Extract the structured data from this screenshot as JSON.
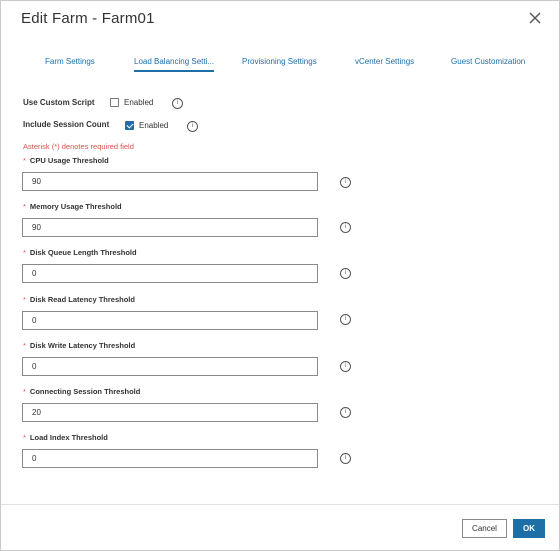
{
  "dialog": {
    "title": "Edit Farm - Farm01",
    "close_icon": "close-icon"
  },
  "tabs": [
    {
      "label": "Farm Settings",
      "active": false
    },
    {
      "label": "Load Balancing Setti...",
      "active": true
    },
    {
      "label": "Provisioning Settings",
      "active": false
    },
    {
      "label": "vCenter Settings",
      "active": false
    },
    {
      "label": "Guest Customization",
      "active": false
    }
  ],
  "options": {
    "custom_script": {
      "label": "Use Custom Script",
      "checkbox_label": "Enabled",
      "checked": false
    },
    "session_count": {
      "label": "Include Session Count",
      "checkbox_label": "Enabled",
      "checked": true
    }
  },
  "required_note": "Asterisk (*) denotes required field",
  "fields": [
    {
      "label": "CPU Usage Threshold",
      "value": "90"
    },
    {
      "label": "Memory Usage Threshold",
      "value": "90"
    },
    {
      "label": "Disk Queue Length Threshold",
      "value": "0"
    },
    {
      "label": "Disk Read Latency Threshold",
      "value": "0"
    },
    {
      "label": "Disk Write Latency Threshold",
      "value": "0"
    },
    {
      "label": "Connecting Session Threshold",
      "value": "20"
    },
    {
      "label": "Load Index Threshold",
      "value": "0"
    }
  ],
  "required_marker": "*",
  "info_glyph": "i",
  "footer": {
    "cancel_label": "Cancel",
    "ok_label": "OK"
  },
  "colors": {
    "accent": "#1d6fa5",
    "required": "#d9534f"
  }
}
